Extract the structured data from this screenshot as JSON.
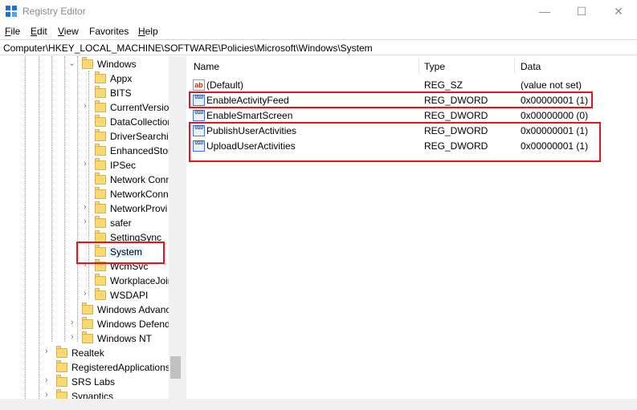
{
  "window": {
    "title": "Registry Editor",
    "minimize": "—",
    "maximize": "☐",
    "close": "✕"
  },
  "menu": [
    {
      "accel": "F",
      "rest": "ile"
    },
    {
      "accel": "E",
      "rest": "dit"
    },
    {
      "accel": "V",
      "rest": "iew"
    },
    {
      "accel": "",
      "rest": "Favorites"
    },
    {
      "accel": "H",
      "rest": "elp"
    }
  ],
  "address": "Computer\\HKEY_LOCAL_MACHINE\\SOFTWARE\\Policies\\Microsoft\\Windows\\System",
  "tree": [
    {
      "label": "Windows",
      "chev": "⌄"
    },
    {
      "label": "Appx",
      "chev": ""
    },
    {
      "label": "BITS",
      "chev": ""
    },
    {
      "label": "CurrentVersion",
      "chev": "›"
    },
    {
      "label": "DataCollection",
      "chev": ""
    },
    {
      "label": "DriverSearching",
      "chev": ""
    },
    {
      "label": "EnhancedStorage",
      "chev": ""
    },
    {
      "label": "IPSec",
      "chev": "›"
    },
    {
      "label": "Network Conn",
      "chev": ""
    },
    {
      "label": "NetworkConn",
      "chev": ""
    },
    {
      "label": "NetworkProvi",
      "chev": "›"
    },
    {
      "label": "safer",
      "chev": "›"
    },
    {
      "label": "SettingSync",
      "chev": ""
    },
    {
      "label": "System",
      "chev": ""
    },
    {
      "label": "WcmSvc",
      "chev": "›"
    },
    {
      "label": "WorkplaceJoin",
      "chev": ""
    },
    {
      "label": "WSDAPI",
      "chev": "›"
    },
    {
      "label": "Windows Advanced",
      "chev": ""
    },
    {
      "label": "Windows Defender",
      "chev": "›"
    },
    {
      "label": "Windows NT",
      "chev": "›"
    },
    {
      "label": "Realtek",
      "chev": "›"
    },
    {
      "label": "RegisteredApplications",
      "chev": ""
    },
    {
      "label": "SRS Labs",
      "chev": "›"
    },
    {
      "label": "Synaptics",
      "chev": "›"
    }
  ],
  "columns": {
    "name": "Name",
    "type": "Type",
    "data": "Data"
  },
  "values": [
    {
      "name": "(Default)",
      "type": "REG_SZ",
      "data": "(value not set)",
      "icon": "ab"
    },
    {
      "name": "EnableActivityFeed",
      "type": "REG_DWORD",
      "data": "0x00000001 (1)",
      "icon": "010"
    },
    {
      "name": "EnableSmartScreen",
      "type": "REG_DWORD",
      "data": "0x00000000 (0)",
      "icon": "010"
    },
    {
      "name": "PublishUserActivities",
      "type": "REG_DWORD",
      "data": "0x00000001 (1)",
      "icon": "010"
    },
    {
      "name": "UploadUserActivities",
      "type": "REG_DWORD",
      "data": "0x00000001 (1)",
      "icon": "010"
    }
  ],
  "colors": {
    "highlight": "#e4141b",
    "folder": "#f8d775"
  }
}
